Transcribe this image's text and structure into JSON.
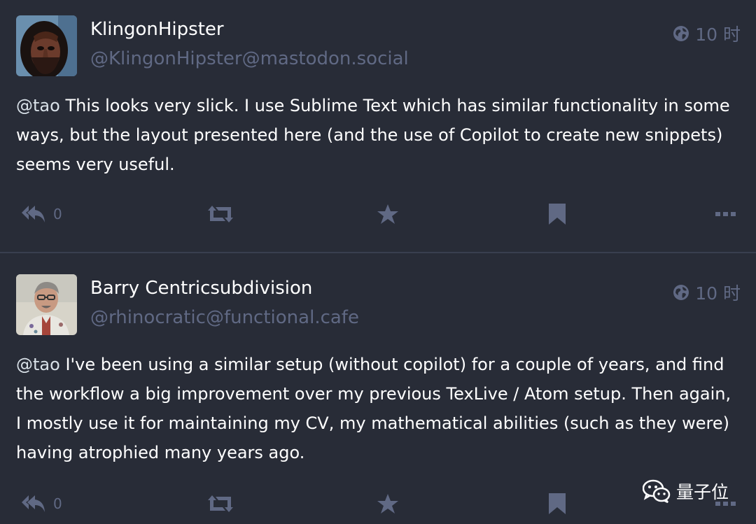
{
  "posts": [
    {
      "display_name": "KlingonHipster",
      "account": "@KlingonHipster@mastodon.social",
      "time": "10 时",
      "mention": "@tao",
      "text": " This looks very slick. I use Sublime Text which has similar functionality in some ways, but the layout presented here (and the use of Copilot to create new snippets) seems very useful.",
      "reply_count": "0",
      "avatar_icon": "klingon-avatar",
      "visibility_icon": "globe-icon"
    },
    {
      "display_name": "Barry Centricsubdivision",
      "account": "@rhinocratic@functional.cafe",
      "time": "10 时",
      "mention": "@tao",
      "text": " I've been using a similar setup (without copilot) for a couple of years, and find the workflow a big improvement over my previous TexLive / Atom setup. Then again, I mostly use it for maintaining my CV, my mathematical abilities (such as they were) having atrophied many years ago.",
      "reply_count": "0",
      "avatar_icon": "person-avatar",
      "visibility_icon": "globe-icon"
    }
  ],
  "watermark": {
    "text": "量子位",
    "icon": "wechat-icon"
  },
  "colors": {
    "background": "#282c37",
    "muted": "#606984",
    "divider": "#393f4f",
    "text": "#ffffff"
  }
}
